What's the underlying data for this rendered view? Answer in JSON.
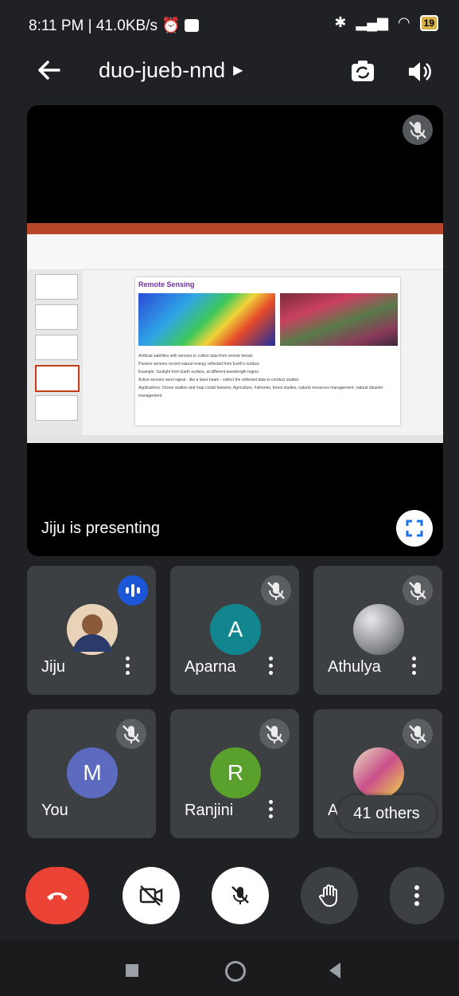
{
  "status_bar": {
    "time_and_speed": "8:11 PM | 41.0KB/s",
    "battery": "19"
  },
  "header": {
    "meeting_code": "duo-jueb-nnd",
    "icons": [
      "back-arrow-icon",
      "switch-camera-icon",
      "speaker-icon"
    ]
  },
  "presentation": {
    "presenting_label": "Jiju is presenting",
    "slide": {
      "title": "Remote Sensing",
      "bullets": [
        "Artificial satellites with sensors to collect data from remote terrain",
        "Passive sensors record natural energy reflected from Earth's surface",
        "Example: Sunlight from Earth surface, at different wavelength region",
        "Active sensors send signal - like a laser beam - collect the reflected data to conduct studies",
        "Applications: Ocean studies and map costal features, Agriculture, Fisheries, forest studies, natural resources management, natural disaster management"
      ]
    }
  },
  "participants": [
    {
      "name": "Jiju",
      "avatar": "photo",
      "avatar_color": "#c9a07a",
      "state": "speaking"
    },
    {
      "name": "Aparna",
      "avatar": "A",
      "avatar_color": "#12868f",
      "state": "muted"
    },
    {
      "name": "Athulya",
      "avatar": "photo",
      "avatar_color": "#9aa0a6",
      "state": "muted"
    },
    {
      "name": "You",
      "avatar": "M",
      "avatar_color": "#5c6bc0",
      "state": "muted"
    },
    {
      "name": "Ranjini",
      "avatar": "R",
      "avatar_color": "#5aa02c",
      "state": "muted"
    },
    {
      "name": "Adithya",
      "avatar": "photo",
      "avatar_color": "#c9508a",
      "state": "muted"
    }
  ],
  "others_label": "41 others",
  "controls": {
    "end_call_color": "#ea4335",
    "buttons": [
      "end-call",
      "camera-off",
      "mic-off",
      "raise-hand",
      "more-options"
    ]
  }
}
